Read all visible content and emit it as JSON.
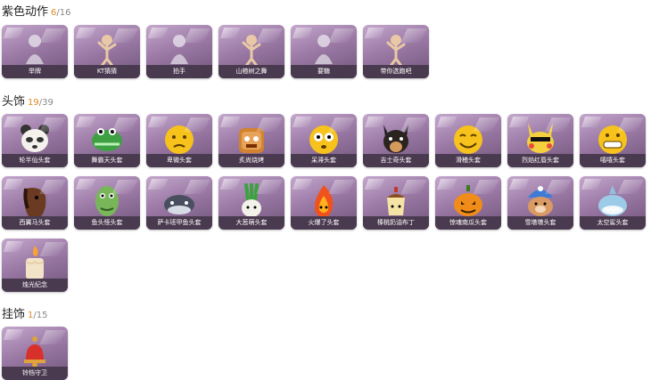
{
  "sections": [
    {
      "title": "紫色动作",
      "owned": "6",
      "total": "/16",
      "items": [
        {
          "label": "举牌",
          "icon": "ghost-figure-icon"
        },
        {
          "label": "KT猜猜",
          "icon": "figure-pose-icon"
        },
        {
          "label": "拍手",
          "icon": "ghost-figure-icon"
        },
        {
          "label": "山楂树之舞",
          "icon": "figure-pose-icon"
        },
        {
          "label": "要糖",
          "icon": "ghost-figure-icon"
        },
        {
          "label": "带你选跑吧",
          "icon": "figure-pose-icon"
        }
      ]
    },
    {
      "title": "头饰",
      "owned": "19",
      "total": "/39",
      "items": [
        {
          "label": "轮半仙头套",
          "icon": "panda-head-icon"
        },
        {
          "label": "舞霸天头套",
          "icon": "crocodile-head-icon"
        },
        {
          "label": "卑微头套",
          "icon": "sad-emoji-icon"
        },
        {
          "label": "炙尚烧烤",
          "icon": "toast-head-icon"
        },
        {
          "label": "呆滞头套",
          "icon": "dazed-emoji-icon"
        },
        {
          "label": "吉士奇头套",
          "icon": "dog-head-icon"
        },
        {
          "label": "滑稽头套",
          "icon": "grin-emoji-icon"
        },
        {
          "label": "烈焰红唇头套",
          "icon": "pikachu-head-icon"
        },
        {
          "label": "嘻嘻头套",
          "icon": "grimace-emoji-icon"
        },
        {
          "label": "西翼马头套",
          "icon": "horse-head-icon"
        },
        {
          "label": "鱼头怪头套",
          "icon": "fish-monster-head-icon"
        },
        {
          "label": "萨卡班甲鱼头套",
          "icon": "fish-head-icon"
        },
        {
          "label": "大葱萌头套",
          "icon": "scallion-head-icon"
        },
        {
          "label": "火爆了头套",
          "icon": "fire-head-icon"
        },
        {
          "label": "榛桃奶油布丁",
          "icon": "pudding-head-icon"
        },
        {
          "label": "惊魂南瓜头套",
          "icon": "pumpkin-head-icon"
        },
        {
          "label": "雪墩墩头套",
          "icon": "snow-bear-head-icon"
        },
        {
          "label": "太空鲨头套",
          "icon": "shark-head-icon"
        },
        {
          "label": "烛光纪念",
          "icon": "candle-head-icon"
        }
      ]
    },
    {
      "title": "挂饰",
      "owned": "1",
      "total": "/15",
      "items": [
        {
          "label": "铃铛守卫",
          "icon": "bell-charm-icon"
        }
      ]
    }
  ]
}
